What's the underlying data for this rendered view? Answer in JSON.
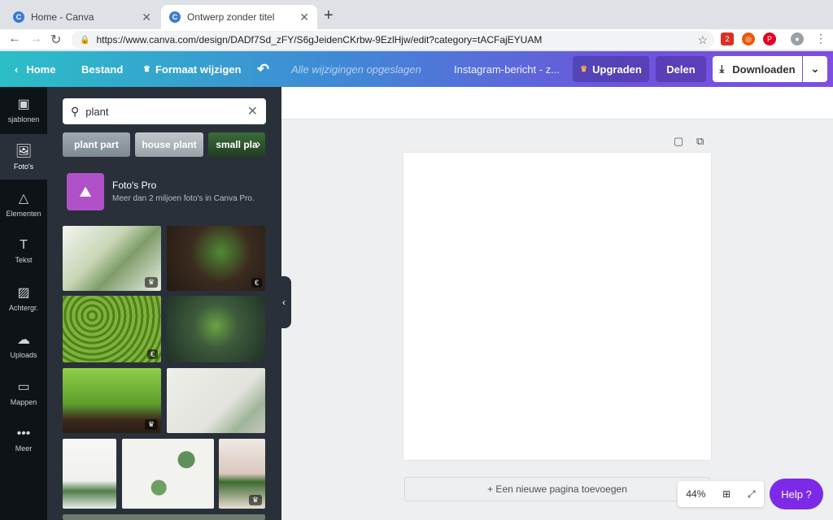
{
  "browser": {
    "tabs": [
      {
        "title": "Home - Canva",
        "favicon": "C"
      },
      {
        "title": "Ontwerp zonder titel",
        "favicon": "C"
      }
    ],
    "url": "https://www.canva.com/design/DADf7Sd_zFY/S6gJeidenCKrbw-9EzlHjw/edit?category=tACFajEYUAM",
    "ext_badge": "2"
  },
  "topbar": {
    "home": "Home",
    "file": "Bestand",
    "resize": "Formaat wijzigen",
    "saved": "Alle wijzigingen opgeslagen",
    "design_name": "Instagram-bericht - z...",
    "upgrade": "Upgraden",
    "share": "Delen",
    "download": "Downloaden"
  },
  "nav": [
    {
      "label": "sjablonen",
      "icon": "template-icon"
    },
    {
      "label": "Foto's",
      "icon": "photo-icon"
    },
    {
      "label": "Elementen",
      "icon": "shapes-icon"
    },
    {
      "label": "Tekst",
      "icon": "text-icon"
    },
    {
      "label": "Achtergr.",
      "icon": "background-icon"
    },
    {
      "label": "Uploads",
      "icon": "upload-icon"
    },
    {
      "label": "Mappen",
      "icon": "folder-icon"
    },
    {
      "label": "Meer",
      "icon": "more-icon"
    }
  ],
  "search": {
    "value": "plant"
  },
  "chips": [
    "plant part",
    "house plant",
    "small pla"
  ],
  "pro": {
    "title": "Foto's Pro",
    "subtitle": "Meer dan 2 miljoen foto's in Canva Pro."
  },
  "photo_badges": {
    "crown": "♛",
    "euro": "€"
  },
  "editor": {
    "add_page": "+ Een nieuwe pagina toevoegen",
    "zoom": "44%",
    "help": "Help ?"
  },
  "colors": {
    "accent": "#7d2ae8",
    "panel": "#293039",
    "nav": "#0e1318"
  }
}
